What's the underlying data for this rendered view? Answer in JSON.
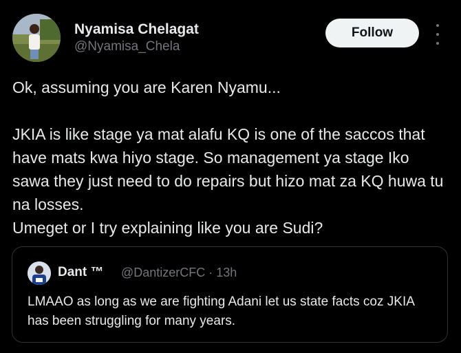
{
  "author": {
    "display_name": "Nyamisa Chelagat",
    "handle": "@Nyamisa_Chela"
  },
  "actions": {
    "follow_label": "Follow",
    "more_icon": "more-vertical-icon"
  },
  "tweet": {
    "text": "Ok, assuming you are Karen Nyamu...\n\nJKIA is like stage ya mat alafu KQ is one of the saccos that have mats kwa hiyo stage. So management ya stage Iko sawa they just need to do repairs but hizo mat za KQ huwa tu na losses.\nUmeget or I try explaining like you are Sudi?"
  },
  "quote": {
    "display_name": "Dant ™",
    "handle_time": "@DantizerCFC · 13h",
    "text": "LMAAO as long as we are fighting Adani let us state facts coz JKIA has been struggling for many years."
  },
  "colors": {
    "background": "#000000",
    "text": "#e7e9ea",
    "secondary": "#71767b",
    "border": "#2f3336",
    "button_bg": "#eff3f4"
  }
}
